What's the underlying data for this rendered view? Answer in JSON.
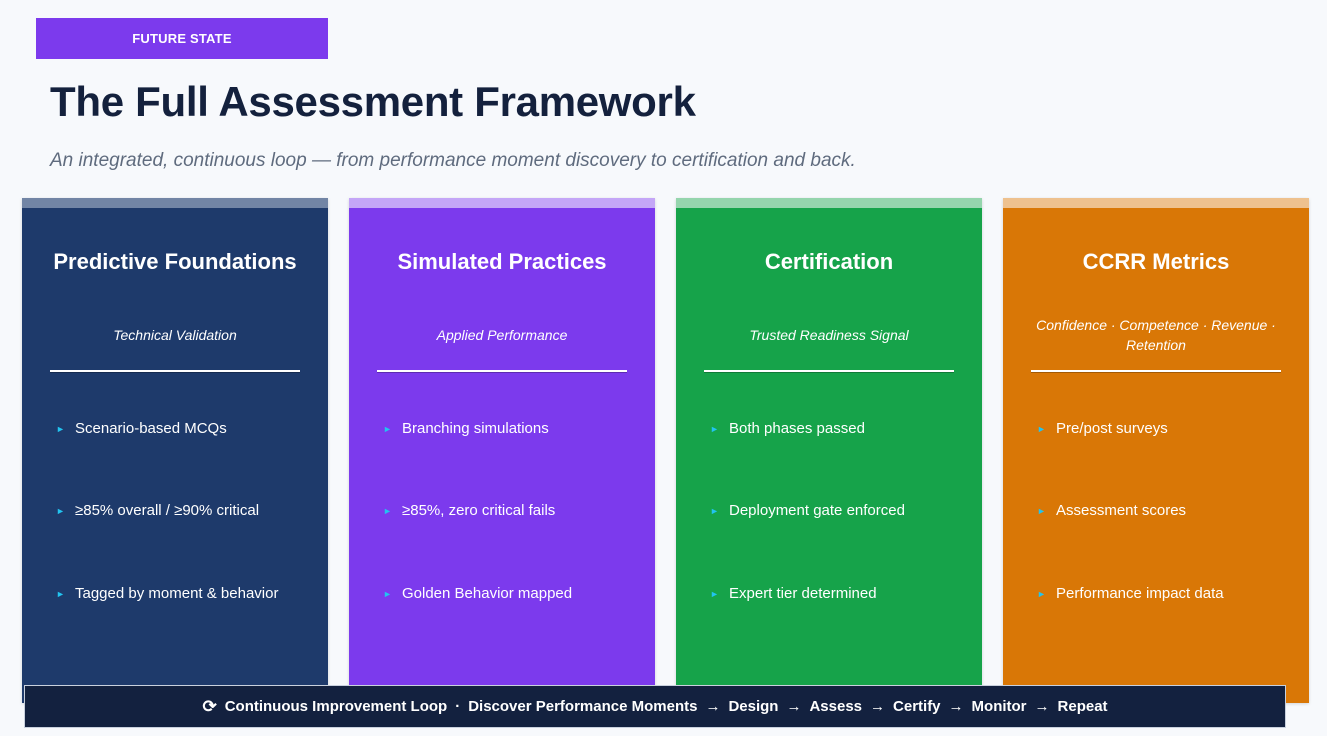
{
  "tag": "FUTURE STATE",
  "title": "The Full Assessment Framework",
  "subtitle": "An integrated, continuous loop — from performance moment discovery to certification and back.",
  "cards": [
    {
      "title": "Predictive Foundations",
      "subtitle": "Technical Validation",
      "color": "#1e3a6b",
      "bullets": [
        "Scenario-based MCQs",
        "≥85% overall / ≥90% critical",
        "Tagged by moment & behavior"
      ]
    },
    {
      "title": "Simulated Practices",
      "subtitle": "Applied Performance",
      "color": "#7c3aed",
      "bullets": [
        "Branching simulations",
        "≥85%, zero critical fails",
        "Golden Behavior mapped"
      ]
    },
    {
      "title": "Certification",
      "subtitle": "Trusted Readiness Signal",
      "color": "#16a34a",
      "bullets": [
        "Both phases passed",
        "Deployment gate enforced",
        "Expert tier determined"
      ]
    },
    {
      "title": "CCRR Metrics",
      "subtitle": "Confidence · Competence · Revenue · Retention",
      "color": "#d97706",
      "bullets": [
        "Pre/post surveys",
        "Assessment scores",
        "Performance impact data"
      ]
    }
  ],
  "footer": {
    "icon": "refresh-icon",
    "label": "Continuous Improvement Loop",
    "separator": "·",
    "steps": [
      "Discover Performance Moments",
      "Design",
      "Assess",
      "Certify",
      "Monitor",
      "Repeat"
    ]
  },
  "colors": {
    "accent_purple": "#7c3aed",
    "navy": "#1e3a6b",
    "green": "#16a34a",
    "orange": "#d97706",
    "bullet_arrow": "#22c4f0",
    "footer_bg": "#13213f"
  }
}
